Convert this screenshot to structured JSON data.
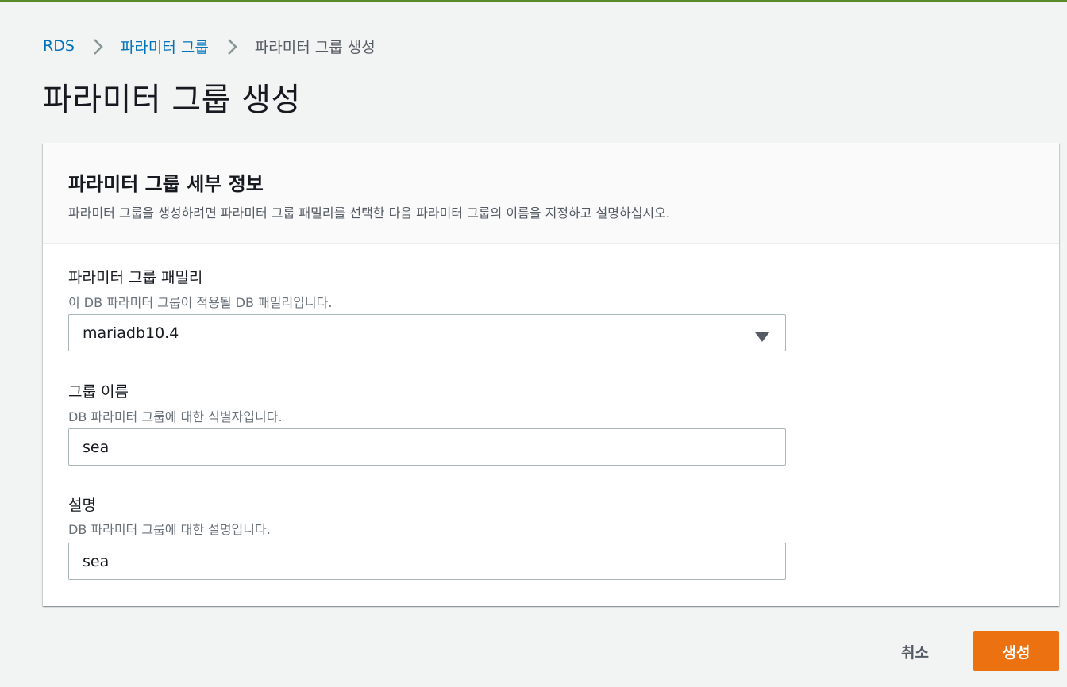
{
  "breadcrumb": {
    "items": [
      "RDS",
      "파라미터 그룹",
      "파라미터 그룹 생성"
    ]
  },
  "page": {
    "title": "파라미터 그룹 생성"
  },
  "panel": {
    "title": "파라미터 그룹 세부 정보",
    "description": "파라미터 그룹을 생성하려면 파라미터 그룹 패밀리를 선택한 다음 파라미터 그룹의 이름을 지정하고 설명하십시오."
  },
  "fields": {
    "family": {
      "label": "파라미터 그룹 패밀리",
      "description": "이 DB 파라미터 그룹이 적용될 DB 패밀리입니다.",
      "value": "mariadb10.4"
    },
    "group_name": {
      "label": "그룹 이름",
      "description": "DB 파라미터 그룹에 대한 식별자입니다.",
      "value": "sea"
    },
    "description": {
      "label": "설명",
      "description": "DB 파라미터 그룹에 대한 설명입니다.",
      "value": "sea"
    }
  },
  "actions": {
    "cancel_label": "취소",
    "create_label": "생성"
  },
  "colors": {
    "link": "#0073bb",
    "primary_button": "#ec7211",
    "top_bar": "#5a8a2a"
  },
  "icons": {
    "breadcrumb_separator": "chevron-right-icon",
    "select_caret": "caret-down-icon"
  }
}
